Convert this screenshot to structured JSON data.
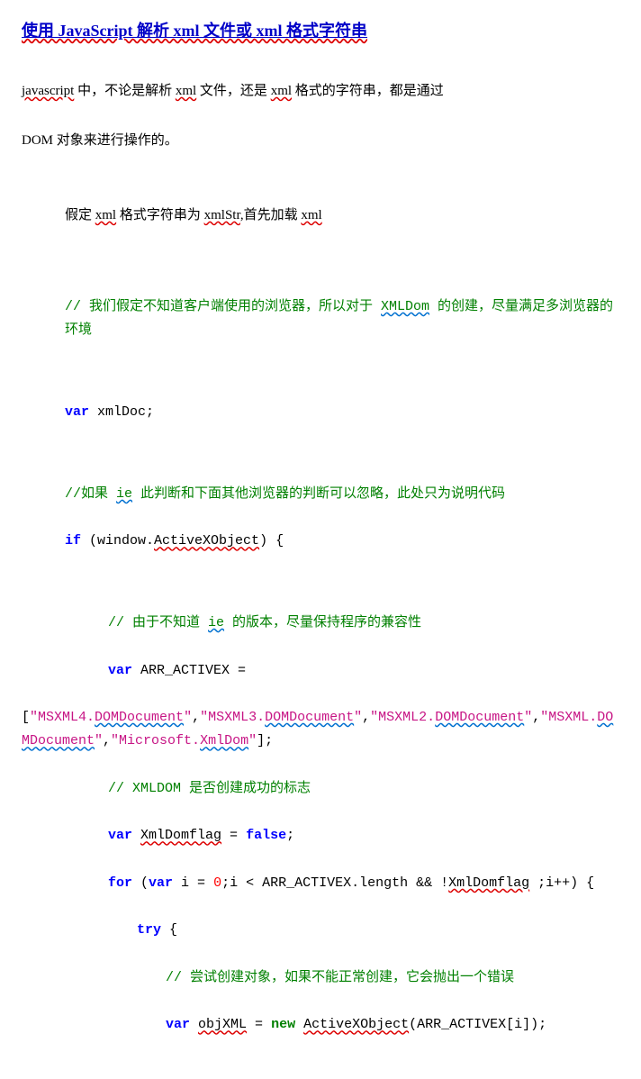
{
  "title": "使用 JavaScript 解析 xml 文件或 xml 格式字符串",
  "intro": {
    "p1_a": "javascript",
    "p1_b": " 中，不论是解析 ",
    "p1_c": "xml",
    "p1_d": " 文件，还是 ",
    "p1_e": "xml",
    "p1_f": " 格式的字符串，都是通过",
    "p2_a": "DOM 对象来进行操作的。"
  },
  "assume": {
    "a": "假定 ",
    "b": "xml",
    "c": " 格式字符串为 ",
    "d": "xmlStr",
    "e": ",首先加载 ",
    "f": "xml"
  },
  "c1": {
    "a": "// 我们假定不知道客户端使用的浏览器，所以对于 ",
    "b": "XMLDom",
    "c": " 的创建，尽量满足多浏览器的环境"
  },
  "l_var_xmldoc": {
    "kw": "var",
    "rest": " xmlDoc;"
  },
  "c2": {
    "a": "//如果 ",
    "b": "ie",
    "c": " 此判断和下面其他浏览器的判断可以忽略，此处只为说明代码"
  },
  "l_if": {
    "kw": "if",
    "a": " (window.",
    "b": "ActiveXObject",
    "c": ") {"
  },
  "c3": {
    "a": "// 由于不知道 ",
    "b": "ie",
    "c": " 的版本，尽量保持程序的兼容性"
  },
  "l_arr": {
    "kw": "var",
    "a": " ARR_ACTIVEX ="
  },
  "arr_parts": {
    "p1": "\"MSXML4.",
    "p2": "DOMDocument",
    "p3": "\"",
    "comma": ",",
    "p4": "\"MSXML3.",
    "p5": "DOMDocument",
    "p6": "\"",
    "p7": "\"MSXML2.",
    "p8": "DOMDocument",
    "p9": "\"",
    "p10": "\"MSXML.",
    "p11": "DOMDocument",
    "p12": "\"",
    "p13": "\"Microsoft.",
    "p14": "XmlDom",
    "p15": "\"",
    "end": "];"
  },
  "c4": "// XMLDOM 是否创建成功的标志",
  "l_flag": {
    "kw": "var",
    "a": " ",
    "b": "XmlDomflag",
    "c": " = ",
    "kw2": "false",
    "d": ";"
  },
  "l_for": {
    "kw": "for",
    "a": " (",
    "kw2": "var",
    "b": " i = ",
    "n": "0",
    "c": ";i < ARR_ACTIVEX.length && !",
    "d": "XmlDomflag",
    "e": " ;i++) {"
  },
  "l_try": {
    "kw": "try",
    "a": " {"
  },
  "c5": "// 尝试创建对象，如果不能正常创建，它会抛出一个错误",
  "l_obj": {
    "kw": "var",
    "a": " ",
    "b": "objXML",
    "c": " = ",
    "kw2": "new",
    "d": " ",
    "e": "ActiveXObject",
    "f": "(ARR_ACTIVEX[i]);"
  }
}
